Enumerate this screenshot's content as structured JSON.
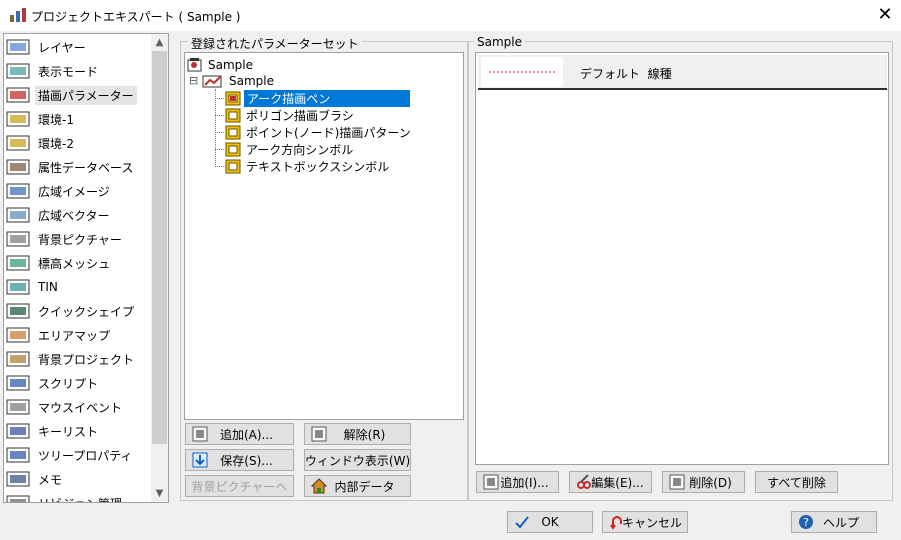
{
  "window": {
    "title": "プロジェクトエキスパート ( Sample )",
    "close_glyph": "✕"
  },
  "nav": {
    "items": [
      {
        "label": "レイヤー",
        "icon": "layer-icon"
      },
      {
        "label": "表示モード",
        "icon": "display-mode-icon"
      },
      {
        "label": "描画パラメーター",
        "icon": "draw-params-icon",
        "selected": true
      },
      {
        "label": "環境-1",
        "icon": "environment-icon"
      },
      {
        "label": "環境-2",
        "icon": "environment-icon"
      },
      {
        "label": "属性データベース",
        "icon": "attribute-db-icon"
      },
      {
        "label": "広域イメージ",
        "icon": "wide-image-icon"
      },
      {
        "label": "広域ベクター",
        "icon": "wide-vector-icon"
      },
      {
        "label": "背景ピクチャー",
        "icon": "background-picture-icon"
      },
      {
        "label": "標高メッシュ",
        "icon": "elevation-mesh-icon"
      },
      {
        "label": "TIN",
        "icon": "tin-icon"
      },
      {
        "label": "クイックシェイプ",
        "icon": "quick-shape-icon"
      },
      {
        "label": "エリアマップ",
        "icon": "area-map-icon"
      },
      {
        "label": "背景プロジェクト",
        "icon": "background-project-icon"
      },
      {
        "label": "スクリプト",
        "icon": "script-icon"
      },
      {
        "label": "マウスイベント",
        "icon": "mouse-icon"
      },
      {
        "label": "キーリスト",
        "icon": "key-list-icon"
      },
      {
        "label": "ツリープロパティ",
        "icon": "tree-property-icon"
      },
      {
        "label": "メモ",
        "icon": "memo-icon"
      },
      {
        "label": "リビジョン管理",
        "icon": "revision-icon"
      }
    ]
  },
  "param_sets": {
    "group_title": "登録されたパラメーターセット",
    "tree": {
      "root": "Sample",
      "child": "Sample",
      "items": [
        "アーク描画ペン",
        "ポリゴン描画ブラシ",
        "ポイント(ノード)描画パターン",
        "アーク方向シンボル",
        "テキストボックスシンボル"
      ],
      "collapse_glyph": "⊟"
    },
    "buttons": {
      "add": "追加(A)...",
      "remove": "解除(R)",
      "save": "保存(S)...",
      "window_view": "ウィンドウ表示(W)",
      "bg_picture": "背景ピクチャーへ",
      "internal": "内部データ"
    }
  },
  "detail": {
    "group_title": "Sample",
    "row_label": "デフォルト  線種",
    "buttons": {
      "add": "追加(I)...",
      "edit": "編集(E)...",
      "delete": "削除(D)",
      "delete_all": "すべて削除"
    }
  },
  "footer": {
    "ok": "OK",
    "cancel": "キャンセル",
    "help": "ヘルプ"
  },
  "colors": {
    "selection": "#0078d7",
    "icon_yellow": "#f5c400",
    "line_red": "#d03030"
  }
}
